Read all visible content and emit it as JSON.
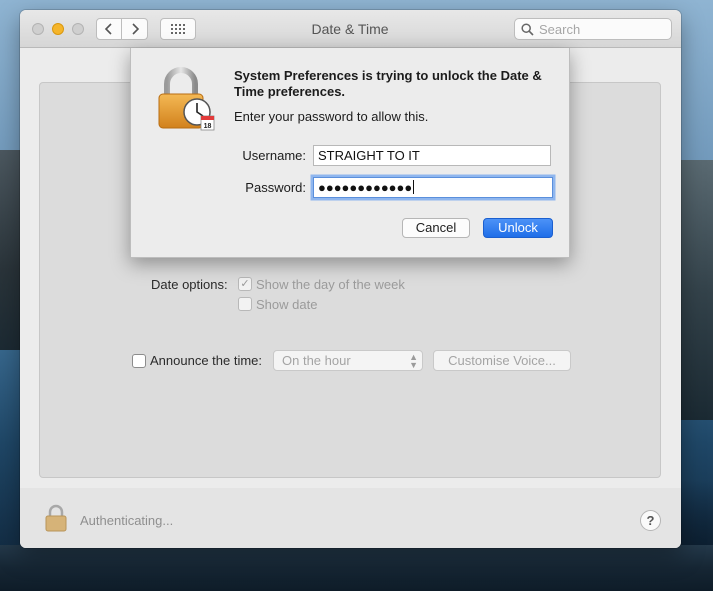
{
  "window": {
    "title": "Date & Time"
  },
  "toolbar": {
    "search_placeholder": "Search"
  },
  "dialog": {
    "title": "System Preferences is trying to unlock the Date & Time preferences.",
    "subtitle": "Enter your password to allow this.",
    "username_label": "Username:",
    "username_value": "STRAIGHT TO IT",
    "password_label": "Password:",
    "password_value": "●●●●●●●●●●●●",
    "cancel_label": "Cancel",
    "unlock_label": "Unlock",
    "icon_date": "18"
  },
  "panel": {
    "date_options_label": "Date options:",
    "show_day_of_week": "Show the day of the week",
    "show_day_checked": true,
    "show_date": "Show date",
    "announce_label": "Announce the time:",
    "announce_interval": "On the hour",
    "customise_voice": "Customise Voice..."
  },
  "footer": {
    "status": "Authenticating..."
  },
  "colors": {
    "accent": "#1f6ee8",
    "lock_gold": "#e9a33a"
  }
}
